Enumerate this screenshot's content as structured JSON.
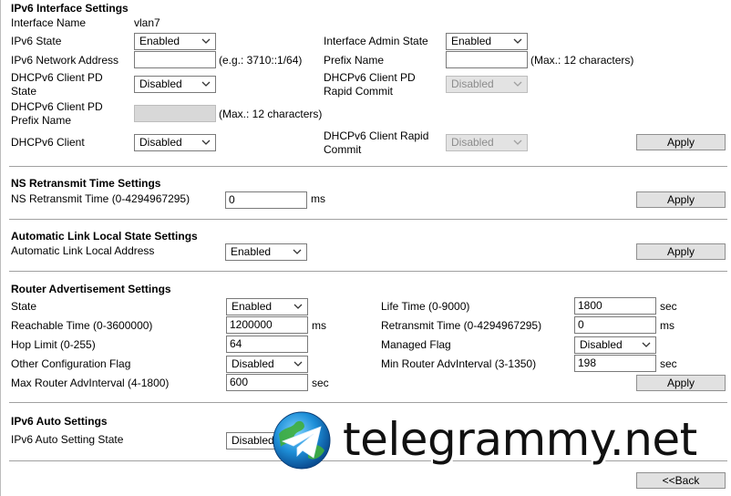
{
  "ipv6_interface": {
    "title": "IPv6 Interface Settings",
    "interface_name_label": "Interface Name",
    "interface_name_value": "vlan7",
    "ipv6_state_label": "IPv6 State",
    "ipv6_state_value": "Enabled",
    "admin_state_label": "Interface Admin State",
    "admin_state_value": "Enabled",
    "network_address_label": "IPv6 Network Address",
    "network_address_value": "",
    "network_address_hint": "(e.g.: 3710::1/64)",
    "prefix_name_label": "Prefix Name",
    "prefix_name_value": "",
    "prefix_name_hint": "(Max.: 12 characters)",
    "pd_state_label_1": "DHCPv6 Client PD",
    "pd_state_label_2": "State",
    "pd_state_value": "Disabled",
    "pd_rapid_label_1": "DHCPv6 Client PD",
    "pd_rapid_label_2": "Rapid Commit",
    "pd_rapid_value": "Disabled",
    "pd_prefix_label_1": "DHCPv6 Client PD",
    "pd_prefix_label_2": "Prefix Name",
    "pd_prefix_value": "",
    "pd_prefix_hint": "(Max.: 12 characters)",
    "client_label": "DHCPv6 Client",
    "client_value": "Disabled",
    "client_rapid_label_1": "DHCPv6 Client Rapid",
    "client_rapid_label_2": "Commit",
    "client_rapid_value": "Disabled",
    "apply_label": "Apply"
  },
  "ns_retransmit": {
    "title": "NS Retransmit Time Settings",
    "label": "NS Retransmit Time (0-4294967295)",
    "value": "0",
    "unit": "ms",
    "apply_label": "Apply"
  },
  "auto_link_local": {
    "title": "Automatic Link Local State Settings",
    "label": "Automatic Link Local Address",
    "value": "Enabled",
    "apply_label": "Apply"
  },
  "router_adv": {
    "title": "Router Advertisement Settings",
    "state_label": "State",
    "state_value": "Enabled",
    "life_time_label": "Life Time (0-9000)",
    "life_time_value": "1800",
    "life_time_unit": "sec",
    "reachable_label": "Reachable Time (0-3600000)",
    "reachable_value": "1200000",
    "reachable_unit": "ms",
    "retransmit_label": "Retransmit Time (0-4294967295)",
    "retransmit_value": "0",
    "retransmit_unit": "ms",
    "hop_limit_label": "Hop Limit (0-255)",
    "hop_limit_value": "64",
    "managed_flag_label": "Managed Flag",
    "managed_flag_value": "Disabled",
    "other_config_label": "Other Configuration Flag",
    "other_config_value": "Disabled",
    "min_adv_label": "Min Router AdvInterval (3-1350)",
    "min_adv_value": "198",
    "min_adv_unit": "sec",
    "max_adv_label": "Max Router AdvInterval (4-1800)",
    "max_adv_value": "600",
    "max_adv_unit": "sec",
    "apply_label": "Apply"
  },
  "ipv6_auto": {
    "title": "IPv6 Auto Settings",
    "label": "IPv6 Auto Setting State",
    "value": "Disabled"
  },
  "back_label": "<<Back",
  "watermark": {
    "text": "telegrammy.net"
  },
  "icons": {
    "dropdown": "chevron-down-icon",
    "watermark_logo": "telegram-globe-icon"
  },
  "colors": {
    "disabled_bg": "#e3e3e3",
    "button_bg": "#e1e1e1",
    "divider": "#a0a0a0"
  }
}
